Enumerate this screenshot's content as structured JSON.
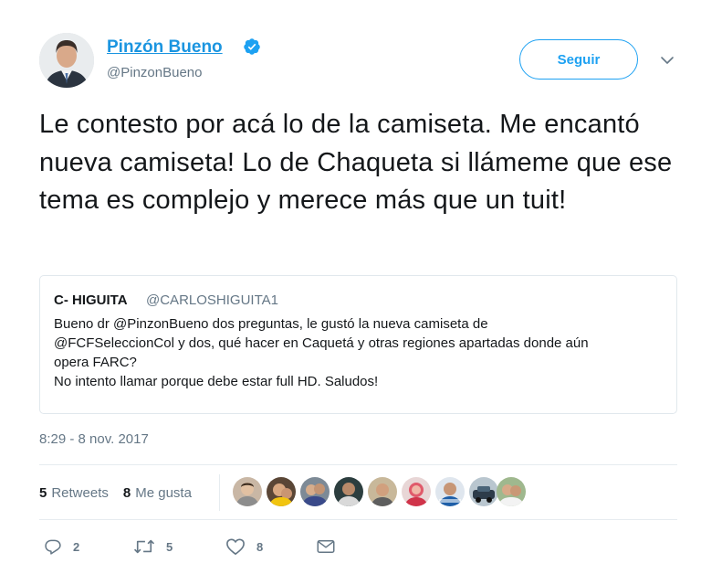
{
  "tweet": {
    "author": {
      "display_name": "Pinzón Bueno",
      "handle": "@PinzonBueno",
      "verified": true
    },
    "follow_label": "Seguir",
    "text": "Le contesto por acá lo de la camiseta. Me encantó nueva camiseta! Lo de Chaqueta si llámeme que ese tema es complejo y merece más que un tuit!",
    "quoted": {
      "name": "C- HIGUITA",
      "handle": "@CARLOSHIGUITA1",
      "lines": [
        "Bueno dr @PinzonBueno dos preguntas, le gustó la nueva camiseta de",
        "@FCFSeleccionCol y dos, qué hacer en Caquetá y otras regiones apartadas donde aún",
        "opera FARC?",
        "No intento llamar porque debe estar full HD. Saludos!"
      ]
    },
    "timestamp": "8:29 - 8 nov. 2017",
    "stats": {
      "retweets_count": "5",
      "retweets_label": "Retweets",
      "likes_count": "8",
      "likes_label": "Me gusta"
    },
    "actions": {
      "reply_count": "2",
      "retweet_count": "5",
      "like_count": "8"
    }
  },
  "icons": [
    "verified-badge-icon",
    "chevron-down-icon",
    "reply-icon",
    "retweet-icon",
    "heart-icon",
    "envelope-icon"
  ],
  "colors": {
    "link_blue": "#1b95e0",
    "accent": "#1da1f2",
    "muted": "#657786",
    "text": "#14171a"
  }
}
